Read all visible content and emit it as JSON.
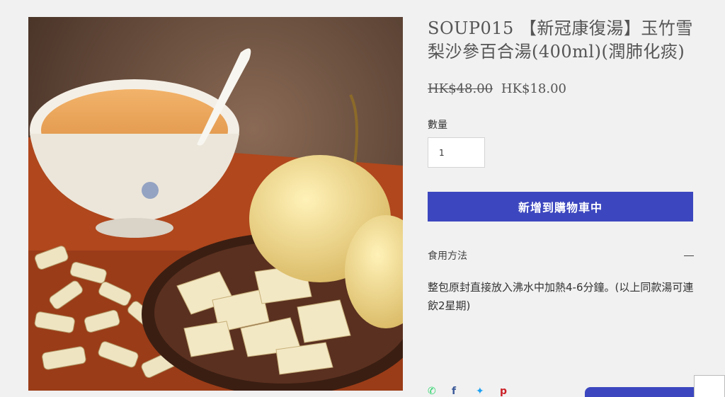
{
  "product": {
    "title": "SOUP015 【新冠康復湯】玉竹雪梨沙參百合湯(400ml)(潤肺化痰)",
    "price_original": "HK$48.00",
    "price_sale": "HK$18.00",
    "image_alt": "玉竹雪梨沙參百合湯",
    "image_icon": "product-photo"
  },
  "quantity": {
    "label": "數量",
    "value": "1"
  },
  "cart": {
    "add_label": "新增到購物車中"
  },
  "usage": {
    "header": "食用方法",
    "text": "整包原封直接放入沸水中加熱4-6分鐘。(以上同款湯可連飲2星期)",
    "toggle_icon": "minus-icon"
  },
  "share": {
    "icons": [
      "whatsapp-icon",
      "facebook-icon",
      "twitter-icon",
      "pinterest-icon"
    ]
  },
  "colors": {
    "accent": "#3c47bf",
    "background": "#f1f1f1",
    "whatsapp": "#25d366",
    "facebook": "#3b5998",
    "twitter": "#1da1f2",
    "pinterest": "#cb2027"
  }
}
